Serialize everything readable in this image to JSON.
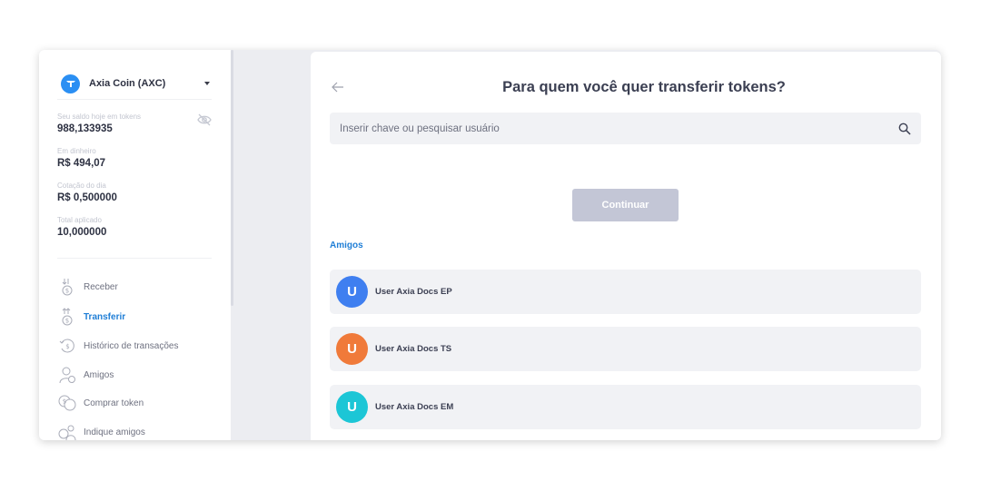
{
  "sidebar": {
    "coin": {
      "name": "Axia Coin (AXC)",
      "logo_color": "#2b8ff3"
    },
    "stats": [
      {
        "label": "Seu saldo hoje em tokens",
        "value": "988,133935"
      },
      {
        "label": "Em dinheiro",
        "value": "R$ 494,07"
      },
      {
        "label": "Cotação do dia",
        "value": "R$ 0,500000"
      },
      {
        "label": "Total aplicado",
        "value": "10,000000"
      }
    ],
    "menu": [
      {
        "label": "Receber",
        "icon": "receive-icon",
        "active": false
      },
      {
        "label": "Transferir",
        "icon": "transfer-icon",
        "active": true
      },
      {
        "label": "Histórico de transações",
        "icon": "history-icon",
        "active": false
      },
      {
        "label": "Amigos",
        "icon": "friends-icon",
        "active": false
      },
      {
        "label": "Comprar token",
        "icon": "buy-token-icon",
        "active": false
      },
      {
        "label": "Indique amigos",
        "icon": "refer-friends-icon",
        "active": false
      }
    ]
  },
  "main": {
    "title": "Para quem você quer transferir tokens?",
    "search_placeholder": "Inserir chave ou pesquisar usuário",
    "continue_label": "Continuar",
    "friends_heading": "Amigos",
    "friends": [
      {
        "initial": "U",
        "name": "User Axia Docs EP",
        "color": "#3f7ff0"
      },
      {
        "initial": "U",
        "name": "User Axia Docs TS",
        "color": "#f07a3a"
      },
      {
        "initial": "U",
        "name": "User Axia Docs EM",
        "color": "#1cc6d6"
      }
    ]
  },
  "colors": {
    "accent": "#1f7ed6",
    "button_disabled": "#c3c6d6",
    "background": "#ecedf1"
  }
}
